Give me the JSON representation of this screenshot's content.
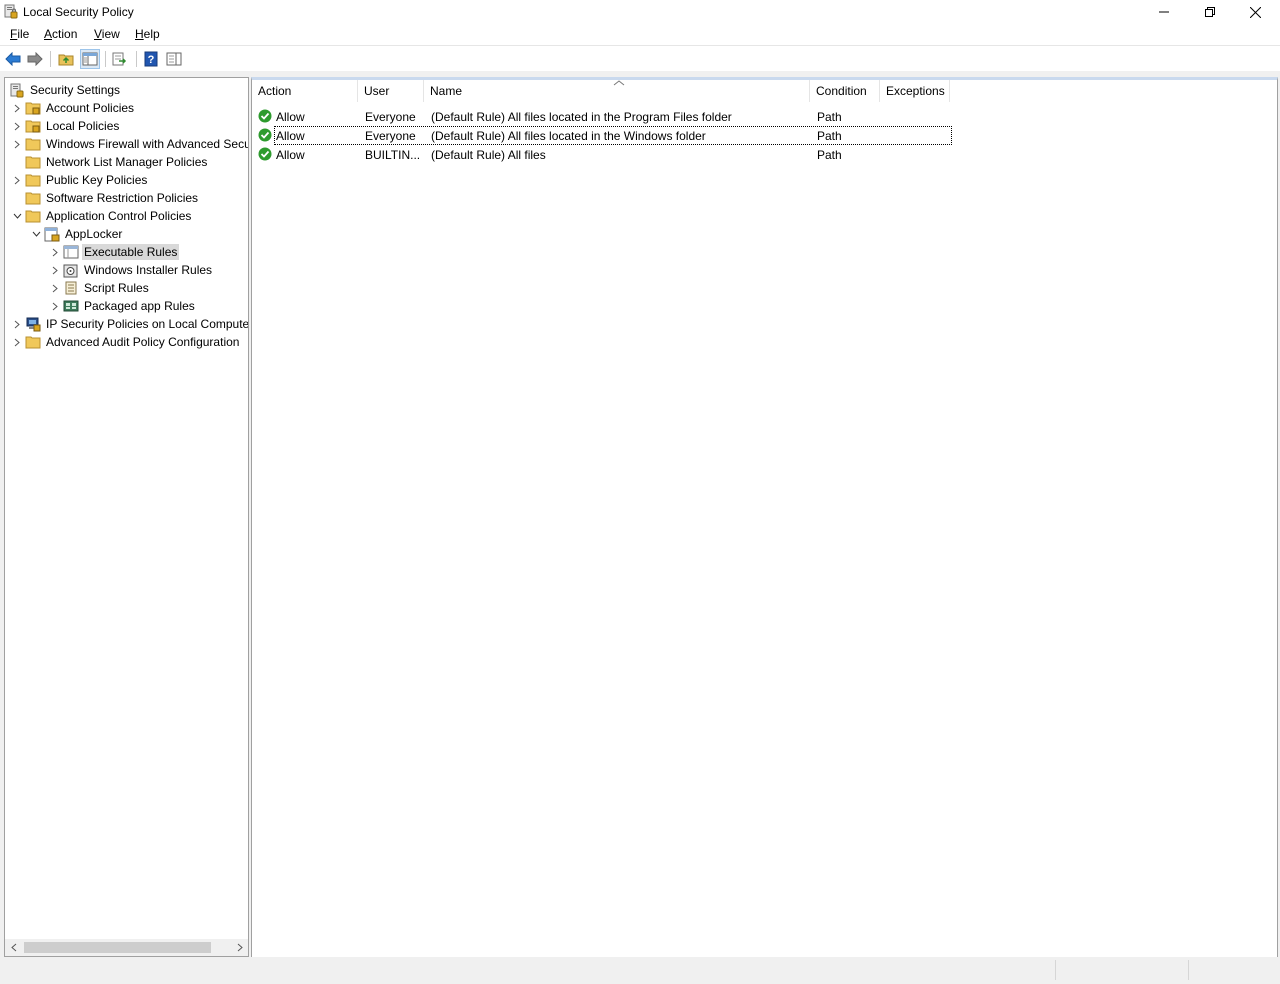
{
  "window": {
    "title": "Local Security Policy",
    "icon": "security-policy-icon"
  },
  "menu": {
    "file": {
      "mnemonic": "F",
      "rest": "ile"
    },
    "action": {
      "mnemonic": "A",
      "rest": "ction"
    },
    "view": {
      "mnemonic": "V",
      "rest": "iew"
    },
    "help": {
      "mnemonic": "H",
      "rest": "elp"
    }
  },
  "toolbar": {
    "icons": [
      "back-arrow-icon",
      "forward-arrow-icon",
      "up-folder-icon",
      "show-hide-console-tree-icon",
      "export-list-icon",
      "help-icon",
      "properties-pane-icon"
    ]
  },
  "tree": {
    "root": "Security Settings",
    "items": [
      {
        "label": "Account Policies"
      },
      {
        "label": "Local Policies"
      },
      {
        "label": "Windows Firewall with Advanced Security"
      },
      {
        "label": "Network List Manager Policies"
      },
      {
        "label": "Public Key Policies"
      },
      {
        "label": "Software Restriction Policies"
      },
      {
        "label": "Application Control Policies"
      },
      {
        "label": "AppLocker"
      },
      {
        "label": "Executable Rules"
      },
      {
        "label": "Windows Installer Rules"
      },
      {
        "label": "Script Rules"
      },
      {
        "label": "Packaged app Rules"
      },
      {
        "label": "IP Security Policies on Local Computer"
      },
      {
        "label": "Advanced Audit Policy Configuration"
      }
    ]
  },
  "list": {
    "columns": [
      "Action",
      "User",
      "Name",
      "Condition",
      "Exceptions"
    ],
    "sorted_column": "Name",
    "rows": [
      {
        "action": "Allow",
        "user": "Everyone",
        "name": "(Default Rule) All files located in the Program Files folder",
        "condition": "Path",
        "exceptions": ""
      },
      {
        "action": "Allow",
        "user": "Everyone",
        "name": "(Default Rule) All files located in the Windows folder",
        "condition": "Path",
        "exceptions": ""
      },
      {
        "action": "Allow",
        "user": "BUILTIN...",
        "name": "(Default Rule) All files",
        "condition": "Path",
        "exceptions": ""
      }
    ]
  },
  "colors": {
    "selection_gray": "#d9d9d9",
    "allow_green": "#2e9b2e",
    "folder_yellow": "#f0c85a",
    "accent_blue": "#1f6fc5"
  }
}
